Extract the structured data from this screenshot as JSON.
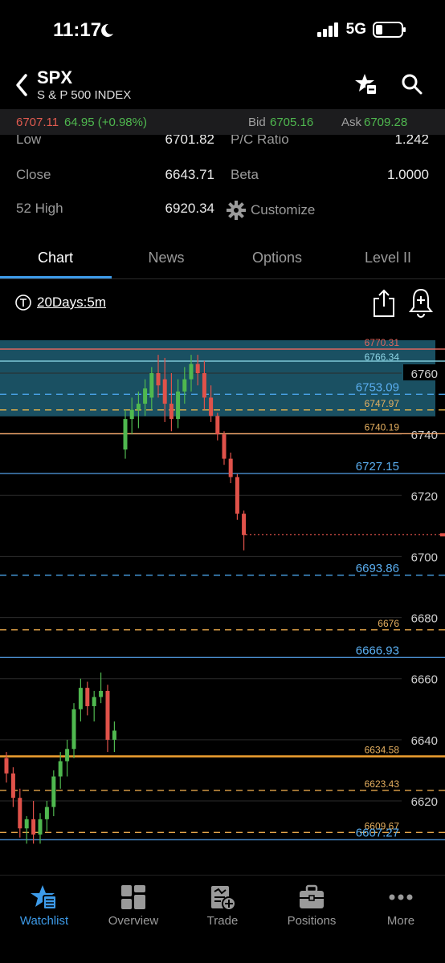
{
  "status": {
    "time": "11:17",
    "network": "5G"
  },
  "header": {
    "symbol": "SPX",
    "name": "S & P 500 INDEX"
  },
  "quote": {
    "last": "6707.11",
    "change": "64.95 (+0.98%)",
    "bid_label": "Bid",
    "bid": "6705.16",
    "ask_label": "Ask",
    "ask": "6709.28"
  },
  "stats": {
    "low_label": "Low",
    "low": "6701.82",
    "pc_label": "P/C Ratio",
    "pc": "1.242",
    "close_label": "Close",
    "close": "6643.71",
    "beta_label": "Beta",
    "beta": "1.0000",
    "high52_label": "52 High",
    "high52": "6920.34",
    "customize_label": "Customize"
  },
  "tabs": [
    "Chart",
    "News",
    "Options",
    "Level II"
  ],
  "active_tab": "Chart",
  "chart_toolbar": {
    "period": "20Days:5m"
  },
  "chart_data": {
    "type": "candlestick",
    "price_ticks": [
      "6760",
      "6740",
      "6720",
      "6700",
      "6680",
      "6660",
      "6640",
      "6620"
    ],
    "level_lines": [
      {
        "value": "6770.31",
        "style": "solid",
        "color": "#e0675f"
      },
      {
        "value": "6766.34",
        "style": "solid",
        "color": "#7ec8d8"
      },
      {
        "value": "6753.09",
        "style": "dashed",
        "color": "#4aa3e8"
      },
      {
        "value": "6747.97",
        "style": "dashed",
        "color": "#e6b54a"
      },
      {
        "value": "6740.19",
        "style": "solid",
        "color": "#f0a46a"
      },
      {
        "value": "6727.15",
        "style": "solid",
        "color": "#4a8fd0"
      },
      {
        "value": "6693.86",
        "style": "dashed",
        "color": "#4aa3e8"
      },
      {
        "value": "6676",
        "style": "dashed",
        "color": "#e6a64a"
      },
      {
        "value": "6666.93",
        "style": "solid",
        "color": "#4a8fd0"
      },
      {
        "value": "6634.58",
        "style": "solid",
        "color": "#f0a030"
      },
      {
        "value": "6623.43",
        "style": "dashed",
        "color": "#e6a64a"
      },
      {
        "value": "6609.67",
        "style": "dashed",
        "color": "#e6a64a"
      },
      {
        "value": "6607.27",
        "style": "solid",
        "color": "#4a8fd0"
      }
    ],
    "upper_session": [
      {
        "o": 6735,
        "h": 6748,
        "l": 6732,
        "c": 6745
      },
      {
        "o": 6745,
        "h": 6752,
        "l": 6740,
        "c": 6748
      },
      {
        "o": 6748,
        "h": 6754,
        "l": 6742,
        "c": 6750
      },
      {
        "o": 6750,
        "h": 6758,
        "l": 6746,
        "c": 6755
      },
      {
        "o": 6752,
        "h": 6762,
        "l": 6748,
        "c": 6760
      },
      {
        "o": 6760,
        "h": 6766,
        "l": 6752,
        "c": 6756
      },
      {
        "o": 6758,
        "h": 6765,
        "l": 6744,
        "c": 6750
      },
      {
        "o": 6750,
        "h": 6760,
        "l": 6741,
        "c": 6745
      },
      {
        "o": 6745,
        "h": 6758,
        "l": 6742,
        "c": 6754
      },
      {
        "o": 6754,
        "h": 6762,
        "l": 6750,
        "c": 6758
      },
      {
        "o": 6758,
        "h": 6766,
        "l": 6754,
        "c": 6763
      },
      {
        "o": 6763,
        "h": 6766,
        "l": 6756,
        "c": 6760
      },
      {
        "o": 6760,
        "h": 6764,
        "l": 6748,
        "c": 6752
      },
      {
        "o": 6752,
        "h": 6756,
        "l": 6744,
        "c": 6746
      },
      {
        "o": 6746,
        "h": 6747,
        "l": 6738,
        "c": 6740
      },
      {
        "o": 6740,
        "h": 6741,
        "l": 6730,
        "c": 6732
      },
      {
        "o": 6732,
        "h": 6734,
        "l": 6724,
        "c": 6726
      },
      {
        "o": 6726,
        "h": 6727,
        "l": 6712,
        "c": 6714
      },
      {
        "o": 6714,
        "h": 6715,
        "l": 6702,
        "c": 6707
      }
    ],
    "lower_session": [
      {
        "o": 6634,
        "h": 6636,
        "l": 6626,
        "c": 6629
      },
      {
        "o": 6629,
        "h": 6631,
        "l": 6618,
        "c": 6621
      },
      {
        "o": 6621,
        "h": 6624,
        "l": 6608,
        "c": 6611
      },
      {
        "o": 6611,
        "h": 6615,
        "l": 6606,
        "c": 6614
      },
      {
        "o": 6614,
        "h": 6620,
        "l": 6606,
        "c": 6609
      },
      {
        "o": 6609,
        "h": 6616,
        "l": 6606,
        "c": 6614
      },
      {
        "o": 6614,
        "h": 6620,
        "l": 6610,
        "c": 6618
      },
      {
        "o": 6618,
        "h": 6630,
        "l": 6615,
        "c": 6628
      },
      {
        "o": 6628,
        "h": 6636,
        "l": 6624,
        "c": 6633
      },
      {
        "o": 6633,
        "h": 6640,
        "l": 6628,
        "c": 6637
      },
      {
        "o": 6637,
        "h": 6652,
        "l": 6634,
        "c": 6650
      },
      {
        "o": 6650,
        "h": 6660,
        "l": 6646,
        "c": 6657
      },
      {
        "o": 6657,
        "h": 6659,
        "l": 6648,
        "c": 6651
      },
      {
        "o": 6651,
        "h": 6656,
        "l": 6646,
        "c": 6654
      },
      {
        "o": 6654,
        "h": 6662,
        "l": 6652,
        "c": 6656
      },
      {
        "o": 6656,
        "h": 6658,
        "l": 6636,
        "c": 6640
      },
      {
        "o": 6640,
        "h": 6646,
        "l": 6636,
        "c": 6643
      }
    ]
  },
  "bottom_nav": [
    "Watchlist",
    "Overview",
    "Trade",
    "Positions",
    "More"
  ],
  "active_nav": "Watchlist",
  "colors": {
    "up": "#4fb84f",
    "down": "#e0524a",
    "accent": "#3d9be9",
    "band": "#1f5e73"
  }
}
